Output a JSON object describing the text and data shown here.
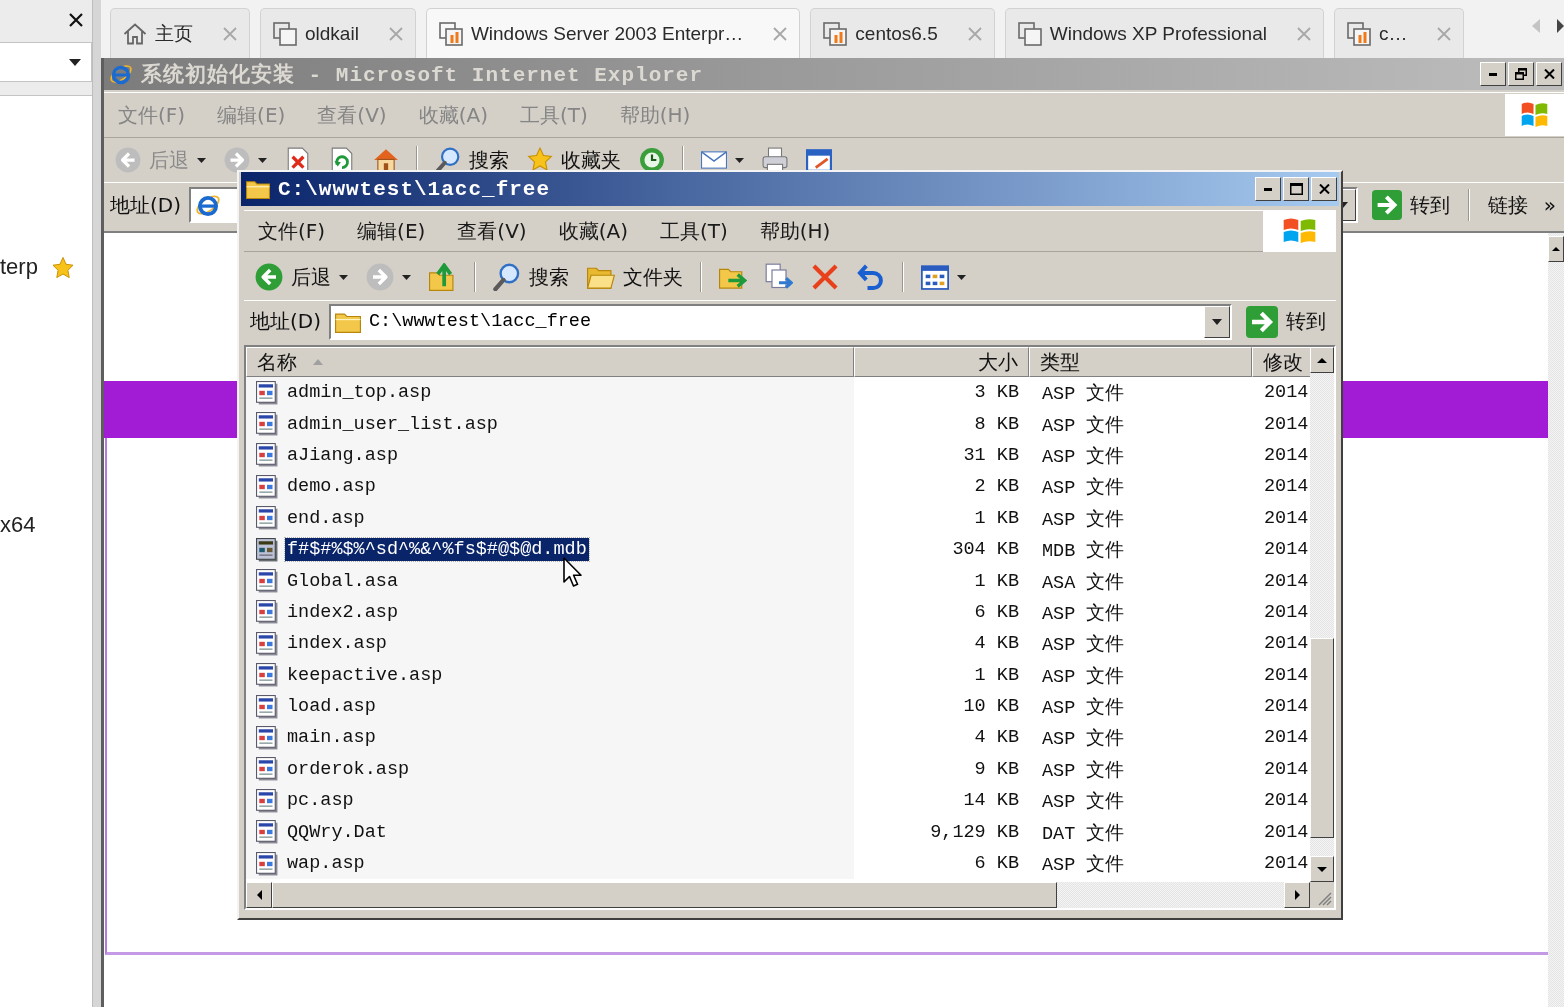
{
  "library": {
    "items": [
      {
        "label": "terp",
        "favorite": true
      },
      {
        "label": "x64",
        "favorite": false
      }
    ]
  },
  "tabs": [
    {
      "label": "主页",
      "kind": "home",
      "selected": false
    },
    {
      "label": "oldkail",
      "kind": "vm",
      "powered_on": false,
      "selected": false
    },
    {
      "label": "Windows Server 2003 Enterpr…",
      "kind": "vm",
      "powered_on": true,
      "selected": true
    },
    {
      "label": "centos6.5",
      "kind": "vm",
      "powered_on": true,
      "selected": false
    },
    {
      "label": "Windows XP Professional",
      "kind": "vm",
      "powered_on": false,
      "selected": false
    },
    {
      "label": "c…",
      "kind": "vm",
      "powered_on": true,
      "selected": false
    }
  ],
  "ie_window": {
    "title": "系统初始化安装 - Microsoft Internet Explorer",
    "active": false,
    "menu": [
      "文件(F)",
      "编辑(E)",
      "查看(V)",
      "收藏(A)",
      "工具(T)",
      "帮助(H)"
    ],
    "toolbar": [
      {
        "kind": "back",
        "label": "后退",
        "disabled": true
      },
      {
        "kind": "forward",
        "disabled": true
      },
      {
        "kind": "stop"
      },
      {
        "kind": "refresh"
      },
      {
        "kind": "home"
      },
      {
        "kind": "separator"
      },
      {
        "kind": "search",
        "label": "搜索"
      },
      {
        "kind": "favorites",
        "label": "收藏夹"
      },
      {
        "kind": "history"
      },
      {
        "kind": "separator"
      },
      {
        "kind": "mail"
      },
      {
        "kind": "print"
      },
      {
        "kind": "edit"
      }
    ],
    "address_label": "地址(D)",
    "go_label": "转到",
    "links_label": "链接",
    "links_more": "»"
  },
  "explorer_window": {
    "title": "C:\\wwwtest\\1acc_free",
    "active": true,
    "menu": [
      "文件(F)",
      "编辑(E)",
      "查看(V)",
      "收藏(A)",
      "工具(T)",
      "帮助(H)"
    ],
    "toolbar": [
      {
        "kind": "back",
        "label": "后退",
        "disabled": false
      },
      {
        "kind": "forward",
        "disabled": true
      },
      {
        "kind": "up"
      },
      {
        "kind": "separator"
      },
      {
        "kind": "search",
        "label": "搜索"
      },
      {
        "kind": "folders",
        "label": "文件夹"
      },
      {
        "kind": "separator"
      },
      {
        "kind": "move"
      },
      {
        "kind": "copy"
      },
      {
        "kind": "delete"
      },
      {
        "kind": "undo"
      },
      {
        "kind": "separator"
      },
      {
        "kind": "views"
      }
    ],
    "address_label": "地址(D)",
    "address": "C:\\wwwtest\\1acc_free",
    "go_label": "转到",
    "columns": [
      {
        "label": "名称",
        "sorted": true
      },
      {
        "label": "大小",
        "sorted": false
      },
      {
        "label": "类型",
        "sorted": false
      },
      {
        "label": "修改",
        "sorted": false
      }
    ],
    "files": [
      {
        "name": "admin_top.asp",
        "size": "3 KB",
        "type": "ASP 文件",
        "modified": "2014",
        "selected": false
      },
      {
        "name": "admin_user_list.asp",
        "size": "8 KB",
        "type": "ASP 文件",
        "modified": "2014",
        "selected": false
      },
      {
        "name": "aJiang.asp",
        "size": "31 KB",
        "type": "ASP 文件",
        "modified": "2014",
        "selected": false
      },
      {
        "name": "demo.asp",
        "size": "2 KB",
        "type": "ASP 文件",
        "modified": "2014",
        "selected": false
      },
      {
        "name": "end.asp",
        "size": "1 KB",
        "type": "ASP 文件",
        "modified": "2014",
        "selected": false
      },
      {
        "name": "f#$#%$%^sd^%&^%fs$#@$@d.mdb",
        "size": "304 KB",
        "type": "MDB 文件",
        "modified": "2014",
        "selected": true
      },
      {
        "name": "Global.asa",
        "size": "1 KB",
        "type": "ASA 文件",
        "modified": "2014",
        "selected": false
      },
      {
        "name": "index2.asp",
        "size": "6 KB",
        "type": "ASP 文件",
        "modified": "2014",
        "selected": false
      },
      {
        "name": "index.asp",
        "size": "4 KB",
        "type": "ASP 文件",
        "modified": "2014",
        "selected": false
      },
      {
        "name": "keepactive.asp",
        "size": "1 KB",
        "type": "ASP 文件",
        "modified": "2014",
        "selected": false
      },
      {
        "name": "load.asp",
        "size": "10 KB",
        "type": "ASP 文件",
        "modified": "2014",
        "selected": false
      },
      {
        "name": "main.asp",
        "size": "4 KB",
        "type": "ASP 文件",
        "modified": "2014",
        "selected": false
      },
      {
        "name": "orderok.asp",
        "size": "9 KB",
        "type": "ASP 文件",
        "modified": "2014",
        "selected": false
      },
      {
        "name": "pc.asp",
        "size": "14 KB",
        "type": "ASP 文件",
        "modified": "2014",
        "selected": false
      },
      {
        "name": "QQWry.Dat",
        "size": "9,129 KB",
        "type": "DAT 文件",
        "modified": "2014",
        "selected": false
      },
      {
        "name": "wap.asp",
        "size": "6 KB",
        "type": "ASP 文件",
        "modified": "2014",
        "selected": false
      }
    ]
  }
}
